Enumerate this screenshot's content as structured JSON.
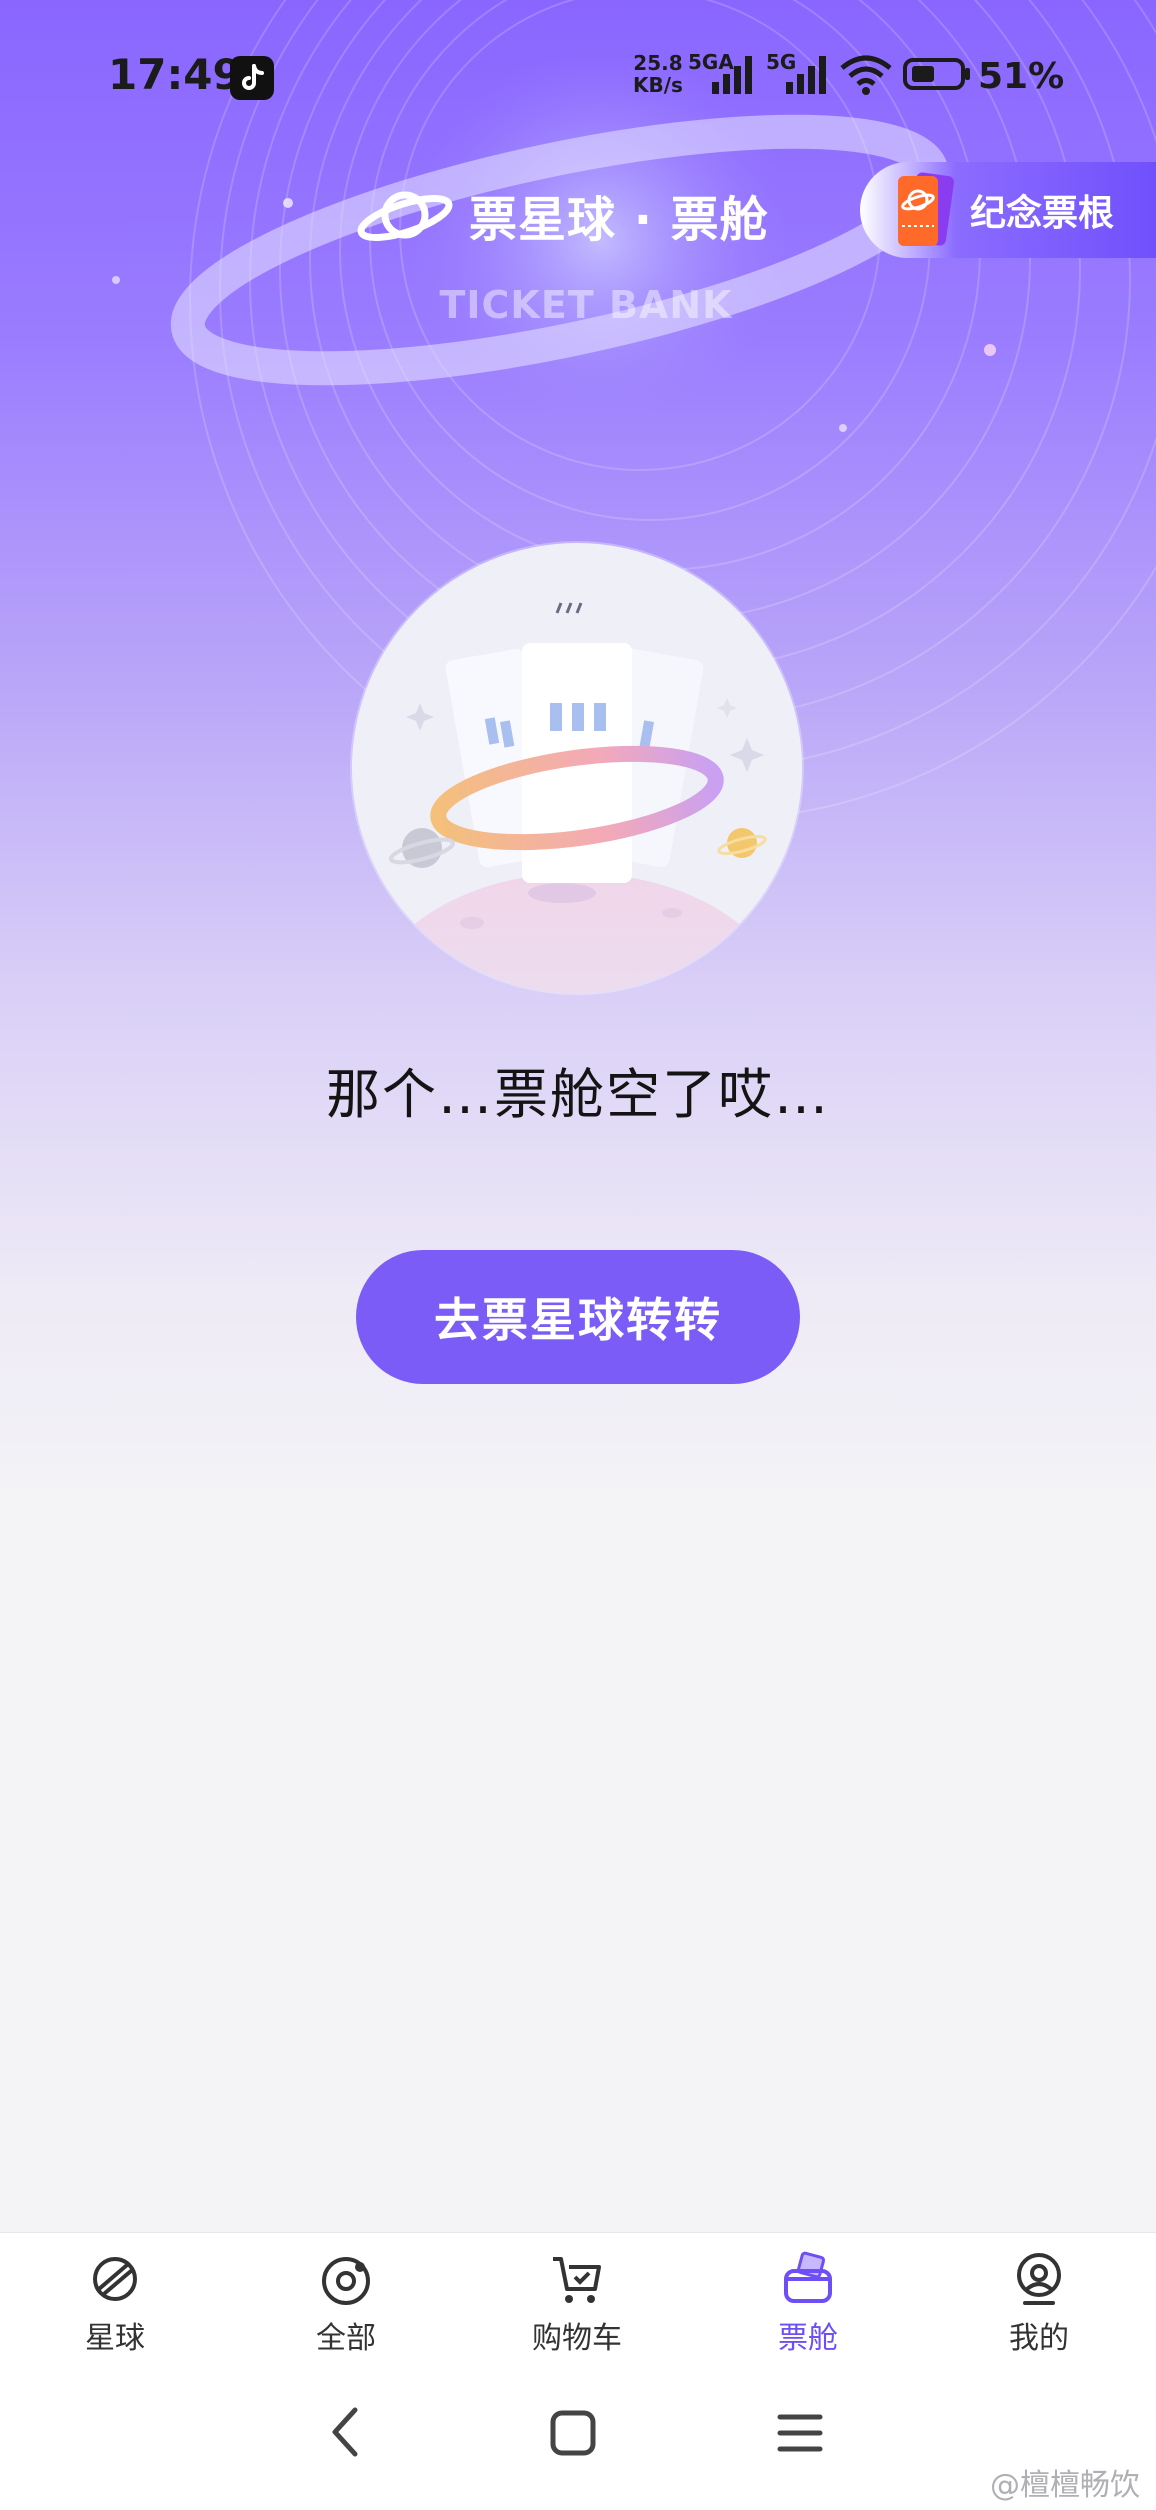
{
  "status_bar": {
    "time": "17:49",
    "net_speed_value": "25.8",
    "net_speed_unit": "KB/s",
    "network_1": "5GA",
    "network_2": "5G",
    "battery": "51%"
  },
  "header": {
    "brand": "票星球 · 票舱",
    "subtitle": "TICKET BANK",
    "souvenir_button": "纪念票根"
  },
  "empty_state": {
    "message": "那个…票舱空了哎…",
    "cta_label": "去票星球转转"
  },
  "bottom_nav": {
    "items": [
      {
        "label": "星球",
        "icon": "planet-icon",
        "active": false
      },
      {
        "label": "全部",
        "icon": "discover-icon",
        "active": false
      },
      {
        "label": "购物车",
        "icon": "cart-icon",
        "active": false
      },
      {
        "label": "票舱",
        "icon": "ticket-wallet-icon",
        "active": true
      },
      {
        "label": "我的",
        "icon": "profile-icon",
        "active": false
      }
    ]
  },
  "system_nav": [
    "back-icon",
    "home-icon",
    "menu-icon"
  ],
  "watermark": "@檀檀畅饮",
  "colors": {
    "accent": "#7c5cf7",
    "active_tab": "#6e4ff5"
  }
}
